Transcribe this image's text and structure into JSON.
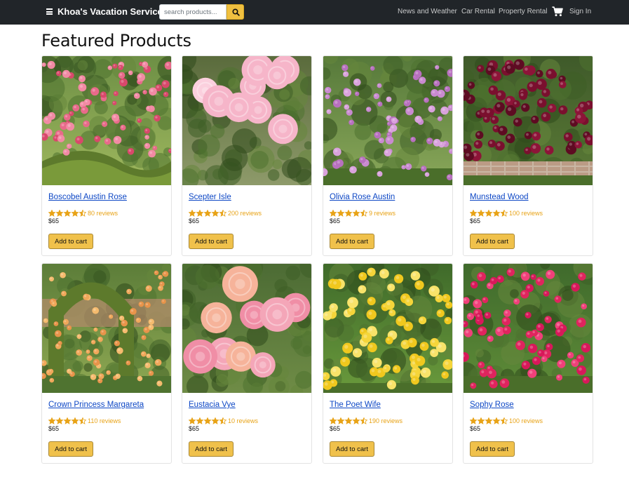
{
  "header": {
    "brand": "Khoa's Vacation Service",
    "search_placeholder": "search products...",
    "nav": [
      "News and Weather",
      "Car Rental",
      "Property Rental"
    ],
    "sign_in": "Sign In"
  },
  "page_title": "Featured Products",
  "add_to_cart_label": "Add to cart",
  "colors": {
    "navbar": "#212529",
    "accent": "#f0c14b",
    "link": "#0d47c5",
    "star": "#e8a317"
  },
  "products": [
    {
      "name": "Boscobel Austin Rose",
      "reviews": "80 reviews",
      "rating": 4.5,
      "price": "$65",
      "image": "pink-rose-garden-hedge"
    },
    {
      "name": "Scepter Isle",
      "reviews": "200 reviews",
      "rating": 4.5,
      "price": "$65",
      "image": "pale-pink-roses-closeup"
    },
    {
      "name": "Olivia Rose Austin",
      "reviews": "9 reviews",
      "rating": 4.5,
      "price": "$65",
      "image": "lilac-rose-border"
    },
    {
      "name": "Munstead Wood",
      "reviews": "100 reviews",
      "rating": 4.5,
      "price": "$65",
      "image": "crimson-rose-bush"
    },
    {
      "name": "Crown Princess Margareta",
      "reviews": "110 reviews",
      "rating": 4.5,
      "price": "$65",
      "image": "apricot-rose-arch"
    },
    {
      "name": "Eustacia Vye",
      "reviews": "10 reviews",
      "rating": 4.5,
      "price": "$65",
      "image": "apricot-pink-roses-closeup"
    },
    {
      "name": "The Poet Wife",
      "reviews": "190 reviews",
      "rating": 4.5,
      "price": "$65",
      "image": "yellow-rose-bush"
    },
    {
      "name": "Sophy Rose",
      "reviews": "100 reviews",
      "rating": 4.5,
      "price": "$65",
      "image": "cerise-rose-border"
    }
  ]
}
